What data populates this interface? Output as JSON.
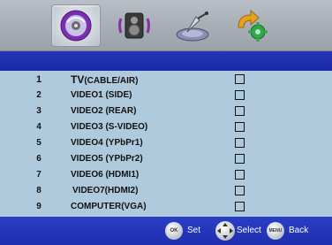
{
  "tabs": [
    {
      "icon": "disc-icon",
      "active": true
    },
    {
      "icon": "speaker-icon",
      "active": false
    },
    {
      "icon": "satellite-dish-icon",
      "active": false
    },
    {
      "icon": "settings-arrows-icon",
      "active": false
    }
  ],
  "inputs": [
    {
      "num": "1",
      "label_main": "TV",
      "label_sub": "(CABLE/AIR)",
      "checked": false
    },
    {
      "num": "2",
      "label_main": "VIDEO1 (SIDE)",
      "label_sub": "",
      "checked": false
    },
    {
      "num": "3",
      "label_main": "VIDEO2 (REAR)",
      "label_sub": "",
      "checked": false
    },
    {
      "num": "4",
      "label_main": "VIDEO3 (S-VIDEO)",
      "label_sub": "",
      "checked": false
    },
    {
      "num": "5",
      "label_main": "VIDEO4 (YPbPr1)",
      "label_sub": "",
      "checked": false
    },
    {
      "num": "6",
      "label_main": "VIDEO5 (YPbPr2)",
      "label_sub": "",
      "checked": false
    },
    {
      "num": "7",
      "label_main": "VIDEO6 (HDMI1)",
      "label_sub": "",
      "checked": false
    },
    {
      "num": "8",
      "label_main": "VIDEO7(HDMI2)",
      "label_sub": "",
      "checked": false
    },
    {
      "num": "9",
      "label_main": "COMPUTER(VGA)",
      "label_sub": "",
      "checked": false
    }
  ],
  "footer": {
    "ok_button": "OK",
    "set_label": "Set",
    "select_label": "Select",
    "menu_button": "MENU",
    "back_label": "Back"
  },
  "colors": {
    "band_blue": "#1e2eae",
    "list_bg": "#b0cadd",
    "tabbar_gray": "#a9b0b8"
  }
}
